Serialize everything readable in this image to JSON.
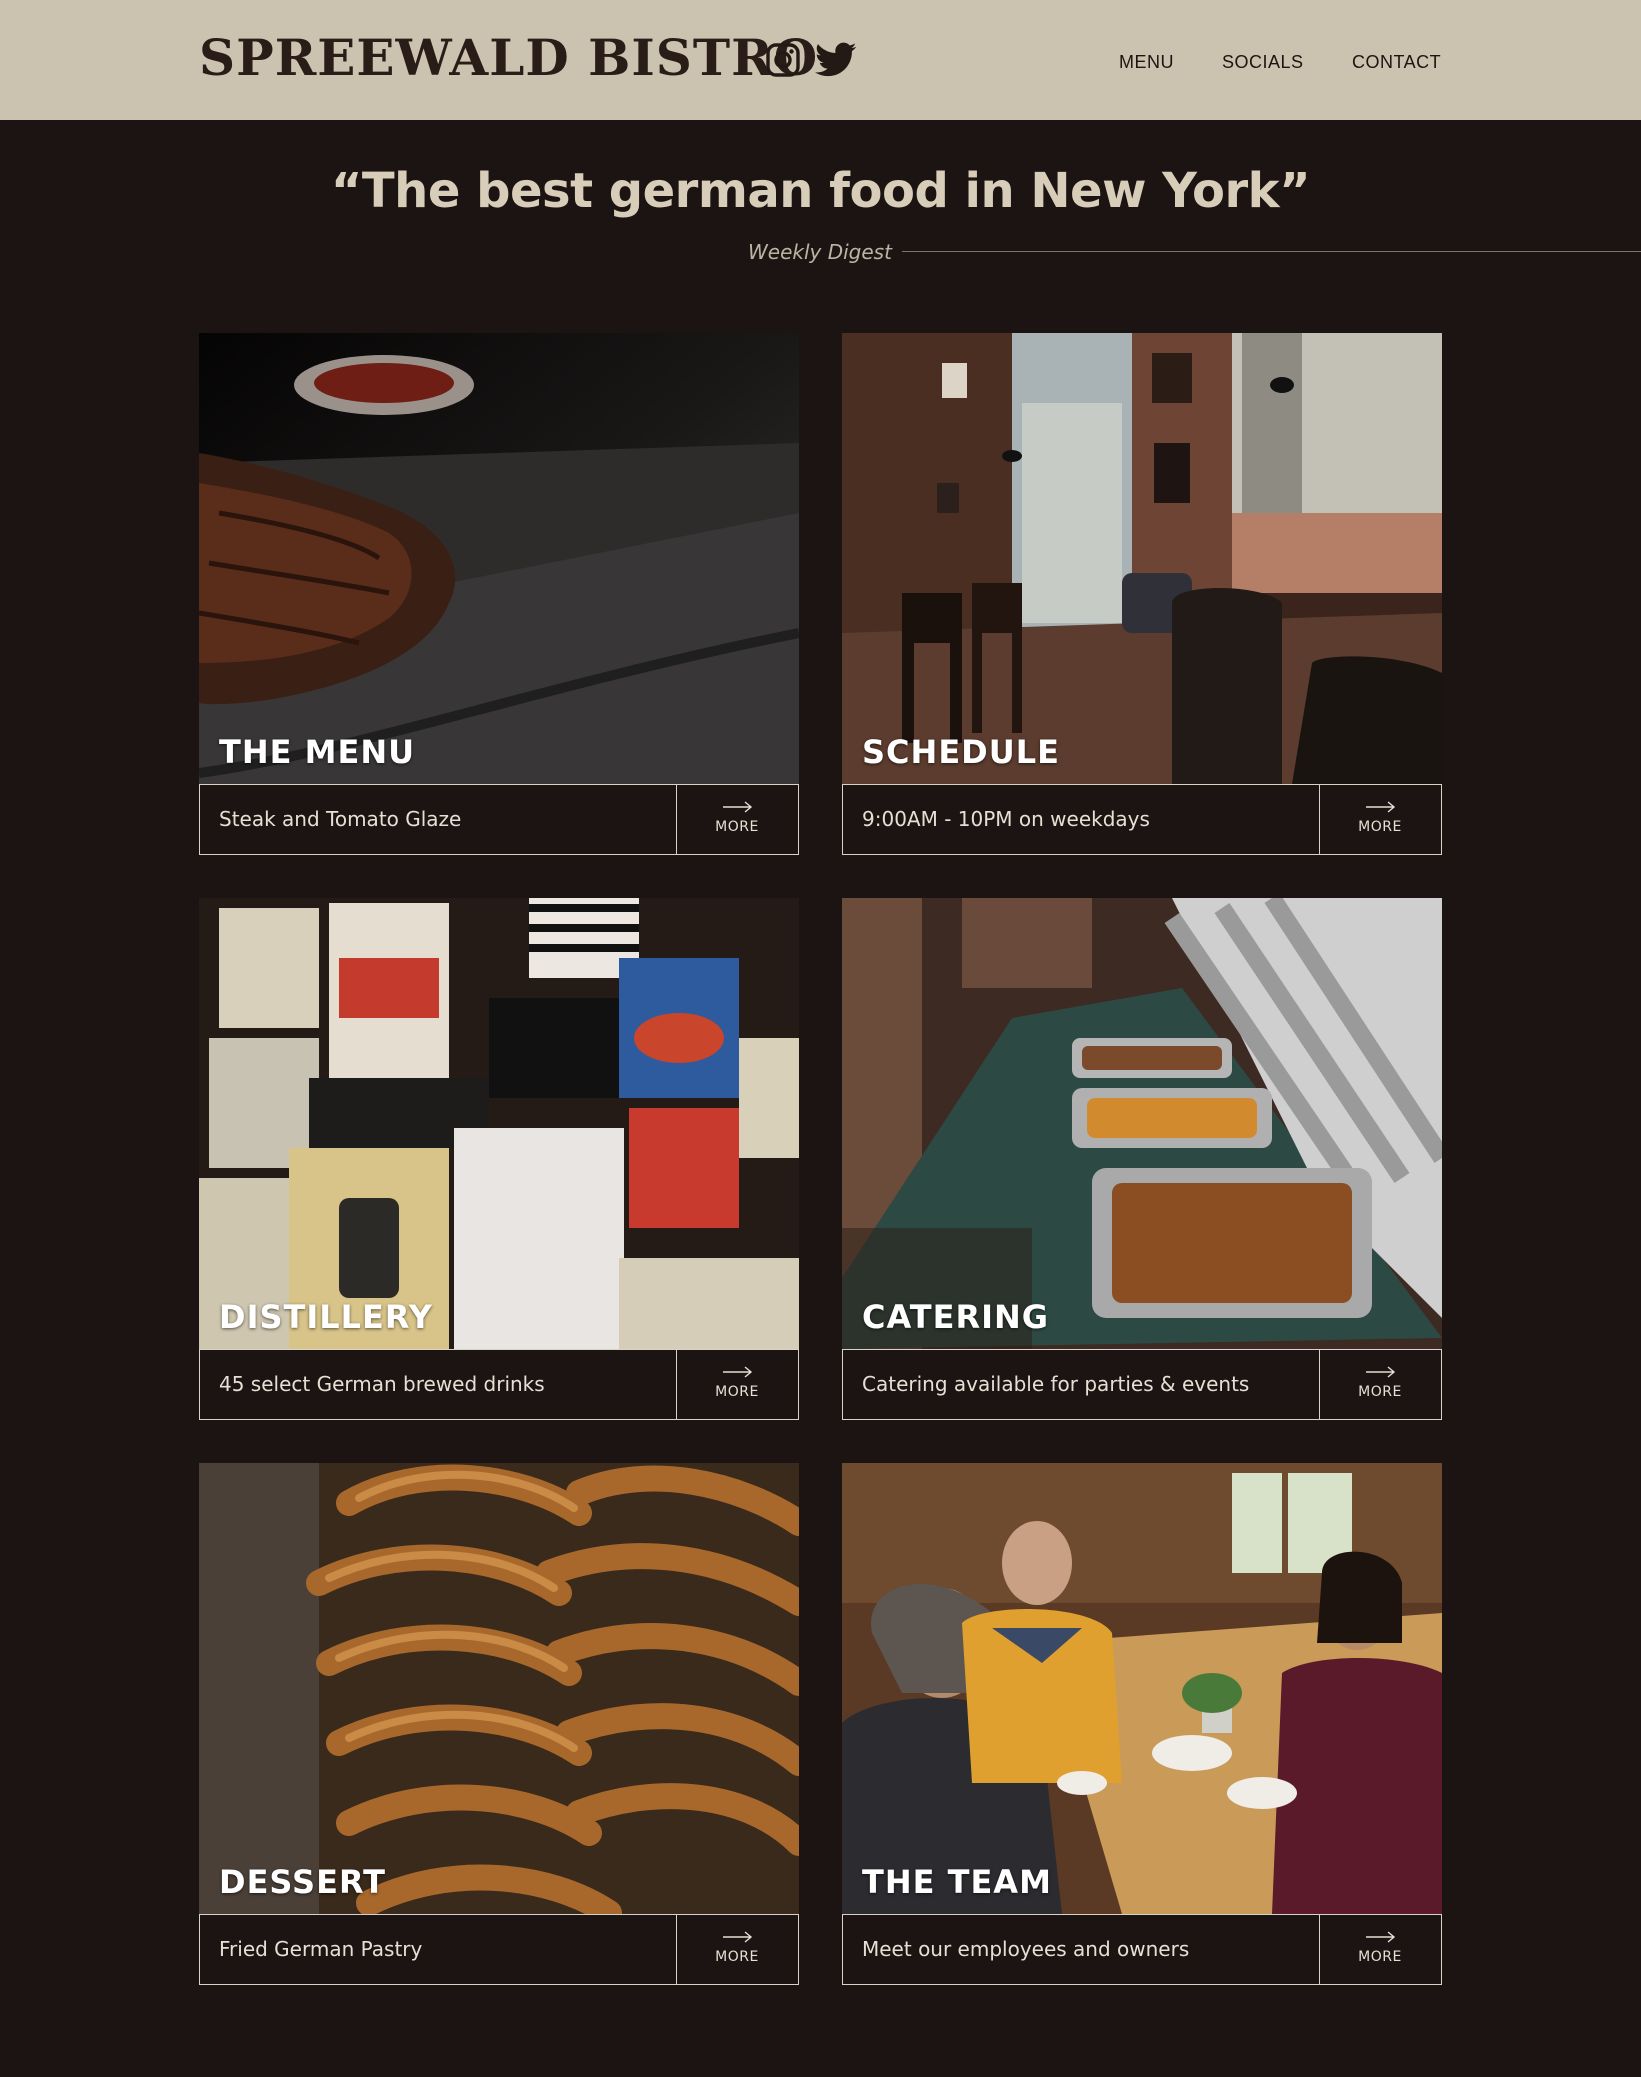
{
  "header": {
    "brand": "SPREEWALD BISTRO",
    "nav": [
      "MENU",
      "SOCIALS",
      "CONTACT"
    ]
  },
  "hero": {
    "quote": "“The best german food in New York”",
    "source": "Weekly Digest"
  },
  "cards": [
    {
      "title": "THE MENU",
      "caption": "Steak and Tomato Glaze",
      "more": "MORE"
    },
    {
      "title": "SCHEDULE",
      "caption": "9:00AM - 10PM on weekdays",
      "more": "MORE"
    },
    {
      "title": "DISTILLERY",
      "caption": "45 select German brewed drinks",
      "more": "MORE"
    },
    {
      "title": "CATERING",
      "caption": "Catering available for parties & events",
      "more": "MORE"
    },
    {
      "title": "DESSERT",
      "caption": "Fried German Pastry",
      "more": "MORE"
    },
    {
      "title": "THE TEAM",
      "caption": "Meet our employees and owners",
      "more": "MORE"
    }
  ],
  "colors": {
    "background": "#1c1413",
    "header_bg": "#cbc2b0",
    "brand_text": "#2a1d17",
    "quote_text": "#d8cdb9"
  },
  "icons": {
    "instagram": "instagram-icon",
    "twitter": "twitter-icon",
    "more_arrow": "arrow-right-icon"
  }
}
